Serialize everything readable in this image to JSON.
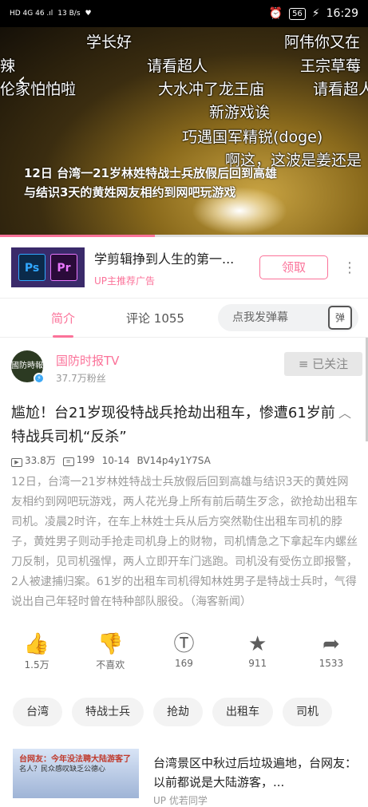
{
  "status_bar": {
    "network": "HD 4G 46 .ıl",
    "speed": "13 B/s",
    "battery": "56",
    "time": "16:29"
  },
  "video": {
    "danmu": [
      {
        "text": "学长好"
      },
      {
        "text": "阿伟你又在"
      },
      {
        "text": "辣"
      },
      {
        "text": "请看超人"
      },
      {
        "text": "王宗草莓"
      },
      {
        "text": "伦家怕怕啦"
      },
      {
        "text": "大水冲了龙王庙"
      },
      {
        "text": "请看超人"
      },
      {
        "text": "新游戏诶"
      },
      {
        "text": "巧遇国军精锐(doge)"
      },
      {
        "text": "啊这，这波是姜还是"
      }
    ],
    "caption_line1": "12日 台湾一21岁林姓特战士兵放假后回到高雄",
    "caption_line2": "与结识3天的黄姓网友相约到网吧玩游戏",
    "progress": 0.42
  },
  "ad": {
    "thumb_ps": "Ps",
    "thumb_pr": "Pr",
    "title": "学剪辑挣到人生的第一...",
    "subtitle": "UP主推荐广告",
    "button": "领取"
  },
  "tabs": {
    "intro": "简介",
    "comments": "评论 1055",
    "danmu_placeholder": "点我发弹幕",
    "danmu_icon": "弹"
  },
  "uploader": {
    "avatar_text": "國防時報",
    "name": "国防时报TV",
    "fans": "37.7万粉丝",
    "follow": "≡ 已关注"
  },
  "video_info": {
    "title": "尴尬！台21岁现役特战兵抢劫出租车，惨遭61岁前特战兵司机“反杀”",
    "views": "33.8万",
    "danmaku_count": "199",
    "date": "10-14",
    "bvid": "BV14p4y1Y7SA",
    "description": "12日，台湾一21岁林姓特战士兵放假后回到高雄与结识3天的黄姓网友相约到网吧玩游戏，两人花光身上所有前后萌生歹念，欲抢劫出租车司机。凌晨2时许，在车上林姓士兵从后方突然勒住出租车司机的脖子，黄姓男子则动手抢走司机身上的财物，司机情急之下拿起车内螺丝刀反制，见司机强悍，两人立即开车门逃跑。司机没有受伤立即报警，2人被逮捕归案。61岁的出租车司机得知林姓男子是特战士兵时，气得说出自己年轻时曾在特种部队服役。（海客新闻）"
  },
  "actions": [
    {
      "icon": "like-icon",
      "label": "1.5万"
    },
    {
      "icon": "dislike-icon",
      "label": "不喜欢"
    },
    {
      "icon": "coin-icon",
      "label": "169"
    },
    {
      "icon": "star-icon",
      "label": "911"
    },
    {
      "icon": "share-icon",
      "label": "1533"
    }
  ],
  "tags": [
    "台湾",
    "特战士兵",
    "抢劫",
    "出租车",
    "司机"
  ],
  "related": {
    "thumb_line1": "台网友：今年没法聘大陆游客了",
    "thumb_line2": "名人？民众感叹缺乏公德心",
    "title": "台湾景区中秋过后垃圾遍地，台网友：以前都说是大陆游客，...",
    "up": "UP 优若同学"
  },
  "colors": {
    "accent": "#fb7299",
    "text": "#212121",
    "muted": "#999999"
  }
}
